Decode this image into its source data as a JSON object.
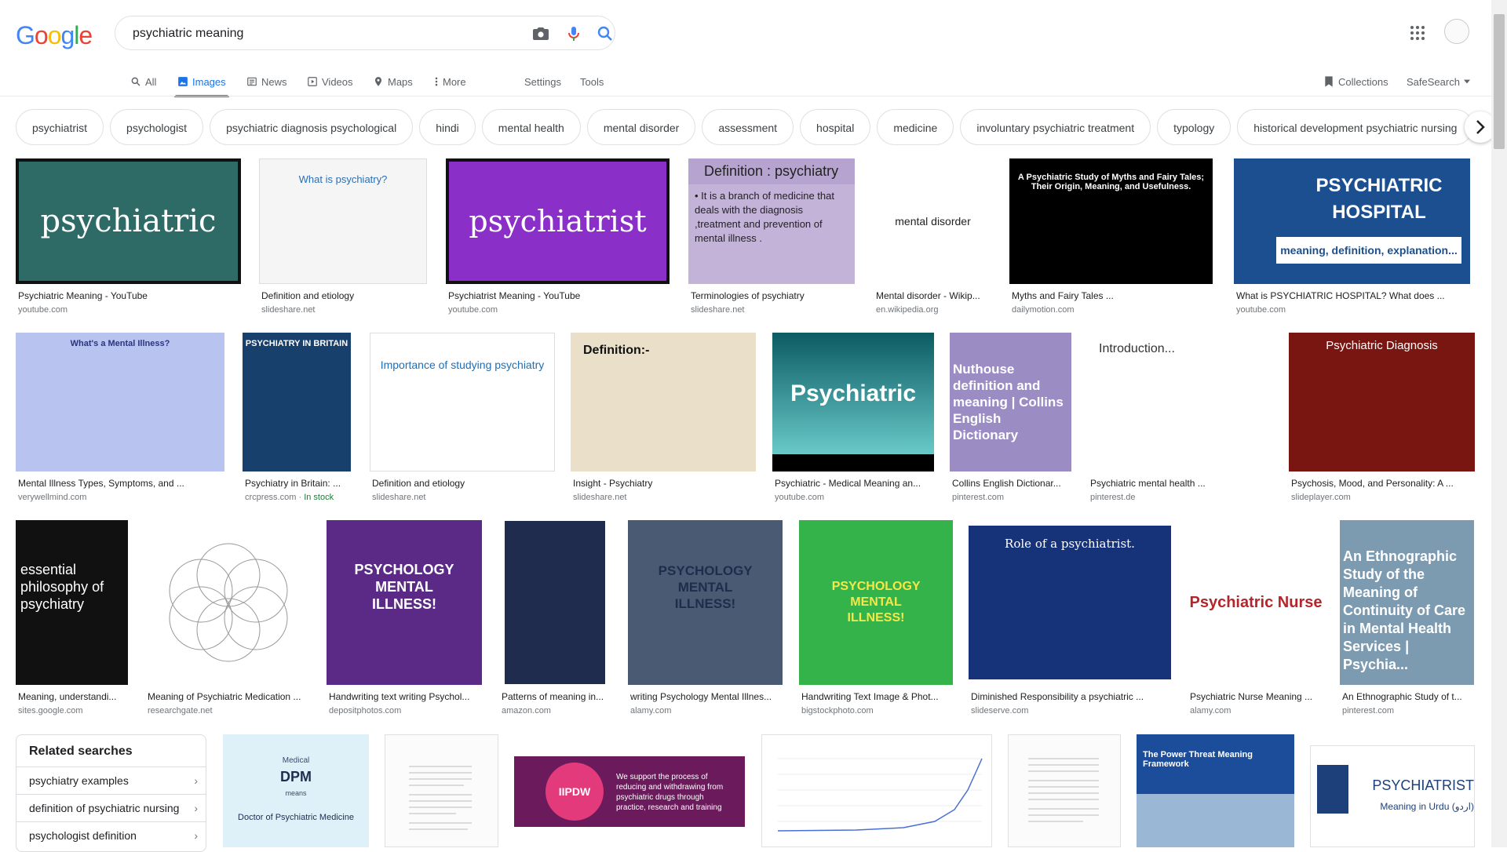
{
  "logo": {
    "g1": "G",
    "o1": "o",
    "o2": "o",
    "g2": "g",
    "l": "l",
    "e": "e"
  },
  "search": {
    "query": "psychiatric meaning"
  },
  "tabs": [
    {
      "label": "All",
      "icon": "search-icon"
    },
    {
      "label": "Images",
      "icon": "image-icon"
    },
    {
      "label": "News",
      "icon": "news-icon"
    },
    {
      "label": "Videos",
      "icon": "video-icon"
    },
    {
      "label": "Maps",
      "icon": "map-icon"
    },
    {
      "label": "More",
      "icon": "more-vert-icon"
    },
    {
      "label": "Settings"
    },
    {
      "label": "Tools"
    }
  ],
  "right_tools": {
    "collections": "Collections",
    "safesearch": "SafeSearch"
  },
  "chips": [
    "psychiatrist",
    "psychologist",
    "psychiatric diagnosis psychological",
    "hindi",
    "mental health",
    "mental disorder",
    "assessment",
    "hospital",
    "medicine",
    "involuntary psychiatric treatment",
    "typology",
    "historical development psychiatric nursing"
  ],
  "results": [
    {
      "title": "Psychiatric Meaning - YouTube",
      "source": "youtube.com",
      "thumb": "psychiatric"
    },
    {
      "title": "Definition and etiology",
      "source": "slideshare.net",
      "thumb": "What is psychiatry?"
    },
    {
      "title": "Psychiatrist Meaning - YouTube",
      "source": "youtube.com",
      "thumb": "psychiatrist"
    },
    {
      "title": "Terminologies of psychiatry",
      "source": "slideshare.net",
      "thumb": "Definition : psychiatry",
      "thumb2": "• It is a branch of medicine that deals with the diagnosis ,treatment and prevention of mental illness ."
    },
    {
      "title": "Mental disorder - Wikip...",
      "source": "en.wikipedia.org",
      "thumb": "mental disorder"
    },
    {
      "title": "Myths and Fairy Tales ...",
      "source": "dailymotion.com",
      "thumb": "A Psychiatric Study of Myths and Fairy Tales; Their Origin, Meaning, and Usefulness."
    },
    {
      "title": "What is PSYCHIATRIC HOSPITAL? What does ...",
      "source": "youtube.com",
      "thumb": "PSYCHIATRIC HOSPITAL",
      "thumb2": "meaning, definition, explanation..."
    },
    {
      "title": "Mental Illness Types, Symptoms, and ...",
      "source": "verywellmind.com",
      "thumb": "What's a Mental Illness?"
    },
    {
      "title": "Psychiatry in Britain: ...",
      "source": "crcpress.com",
      "extra": "In stock",
      "thumb": "PSYCHIATRY IN BRITAIN"
    },
    {
      "title": "Definition and etiology",
      "source": "slideshare.net",
      "thumb": "Importance of studying psychiatry"
    },
    {
      "title": "Insight - Psychiatry",
      "source": "slideshare.net",
      "thumb": "Definition:-"
    },
    {
      "title": "Psychiatric - Medical Meaning an...",
      "source": "youtube.com",
      "thumb": "Psychiatric"
    },
    {
      "title": "Collins English Dictionar...",
      "source": "pinterest.com",
      "thumb": "Nuthouse definition and meaning | Collins English Dictionary"
    },
    {
      "title": "Psychiatric mental health ...",
      "source": "pinterest.de",
      "thumb": "Introduction..."
    },
    {
      "title": "Psychosis, Mood, and Personality: A ...",
      "source": "slideplayer.com",
      "thumb": "Psychiatric Diagnosis"
    },
    {
      "title": "Meaning, understandi...",
      "source": "sites.google.com",
      "thumb": "essential philosophy of psychiatry"
    },
    {
      "title": "Meaning of Psychiatric Medication ...",
      "source": "researchgate.net",
      "thumb": ""
    },
    {
      "title": "Handwriting text writing Psychol...",
      "source": "depositphotos.com",
      "thumb": "PSYCHOLOGY MENTAL ILLNESS!"
    },
    {
      "title": "Patterns of meaning in...",
      "source": "amazon.com",
      "thumb": ""
    },
    {
      "title": "writing Psychology Mental Illnes...",
      "source": "alamy.com",
      "thumb": "PSYCHOLOGY MENTAL ILLNESS!"
    },
    {
      "title": "Handwriting Text Image & Phot...",
      "source": "bigstockphoto.com",
      "thumb": "PSYCHOLOGY MENTAL ILLNESS!"
    },
    {
      "title": "Diminished Responsibility a psychiatric ...",
      "source": "slideserve.com",
      "thumb": "Role of a psychiatrist."
    },
    {
      "title": "Psychiatric Nurse Meaning ...",
      "source": "alamy.com",
      "thumb": "Psychiatric Nurse"
    },
    {
      "title": "An Ethnographic Study of t...",
      "source": "pinterest.com",
      "thumb": "An Ethnographic Study of the Meaning of Continuity of Care in Mental Health Services | Psychia..."
    }
  ],
  "bottom_thumbs": {
    "dpm_small": "Medical",
    "dpm_big": "DPM",
    "dpm_means": "means",
    "dpm_text": "Doctor of Psychiatric Medicine",
    "iipdw": "IIPDW",
    "iipdw_text": "We support the process of reducing and withdrawing from psychiatric drugs through practice, research and training",
    "ptm": "The Power Threat Meaning Framework",
    "urdu_title": "PSYCHIATRIST",
    "urdu_sub": "Meaning in Urdu (اردو)"
  },
  "related": {
    "heading": "Related searches",
    "items": [
      "psychiatry examples",
      "definition of psychiatric nursing",
      "psychologist definition"
    ]
  },
  "colors": {
    "blue": "#4285f4",
    "red": "#ea4335",
    "yellow": "#fbbc05",
    "green": "#34a853",
    "accent": "#1a73e8"
  }
}
